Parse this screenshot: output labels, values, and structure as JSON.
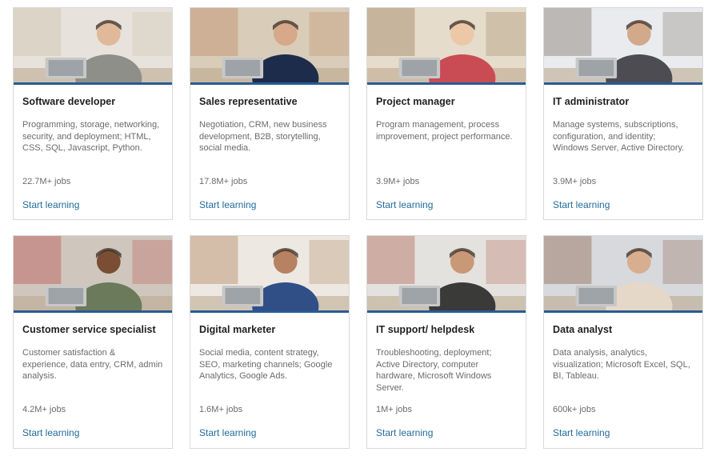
{
  "cards": [
    {
      "title": "Software developer",
      "description": "Programming, storage, networking, security, and deployment; HTML, CSS, SQL, Javascript, Python.",
      "jobs": "22.7M+ jobs",
      "cta": "Start learning",
      "image_colors": {
        "bg": "#e7e3dc",
        "accent": "#c9b79f",
        "person": "#8f8f8a",
        "skin": "#e0b89a"
      }
    },
    {
      "title": "Sales representative",
      "description": "Negotiation, CRM, new business development, B2B, storytelling, social media.",
      "jobs": "17.8M+ jobs",
      "cta": "Start learning",
      "image_colors": {
        "bg": "#d9ccb8",
        "accent": "#b87a55",
        "person": "#1d2c4a",
        "skin": "#d7a88a"
      }
    },
    {
      "title": "Project manager",
      "description": "Program management, process improvement, project performance.",
      "jobs": "3.9M+ jobs",
      "cta": "Start learning",
      "image_colors": {
        "bg": "#e6dccb",
        "accent": "#8a6a45",
        "person": "#c94b54",
        "skin": "#ecc8a8"
      }
    },
    {
      "title": "IT administrator",
      "description": "Manage systems, subscriptions, configuration, and identity; Windows Server, Active Directory.",
      "jobs": "3.9M+ jobs",
      "cta": "Start learning",
      "image_colors": {
        "bg": "#e9ebee",
        "accent": "#6b5a4a",
        "person": "#4c4c52",
        "skin": "#d3a98b"
      }
    },
    {
      "title": "Customer service specialist",
      "description": "Customer satisfaction & experience, data entry, CRM, admin analysis.",
      "jobs": "4.2M+ jobs",
      "cta": "Start learning",
      "image_colors": {
        "bg": "#cfc7bd",
        "accent": "#b83a3a",
        "person": "#6b7a5a",
        "skin": "#7a4e35"
      }
    },
    {
      "title": "Digital marketer",
      "description": "Social media, content strategy, SEO, marketing channels; Google Analytics, Google Ads.",
      "jobs": "1.6M+ jobs",
      "cta": "Start learning",
      "image_colors": {
        "bg": "#ede8e2",
        "accent": "#a56e3e",
        "person": "#2f4f86",
        "skin": "#b68262"
      }
    },
    {
      "title": "IT support/ helpdesk",
      "description": "Troubleshooting, deployment; Active Directory, computer hardware, Microsoft Windows Server.",
      "jobs": "1M+ jobs",
      "cta": "Start learning",
      "image_colors": {
        "bg": "#e4e2de",
        "accent": "#a64a3a",
        "person": "#3a3a38",
        "skin": "#c89877"
      }
    },
    {
      "title": "Data analyst",
      "description": "Data analysis, analytics, visualization; Microsoft Excel, SQL, BI, Tableau.",
      "jobs": "600k+ jobs",
      "cta": "Start learning",
      "image_colors": {
        "bg": "#d7d9dc",
        "accent": "#7a4b2e",
        "person": "#e6d8c8",
        "skin": "#d8ae90"
      }
    }
  ]
}
